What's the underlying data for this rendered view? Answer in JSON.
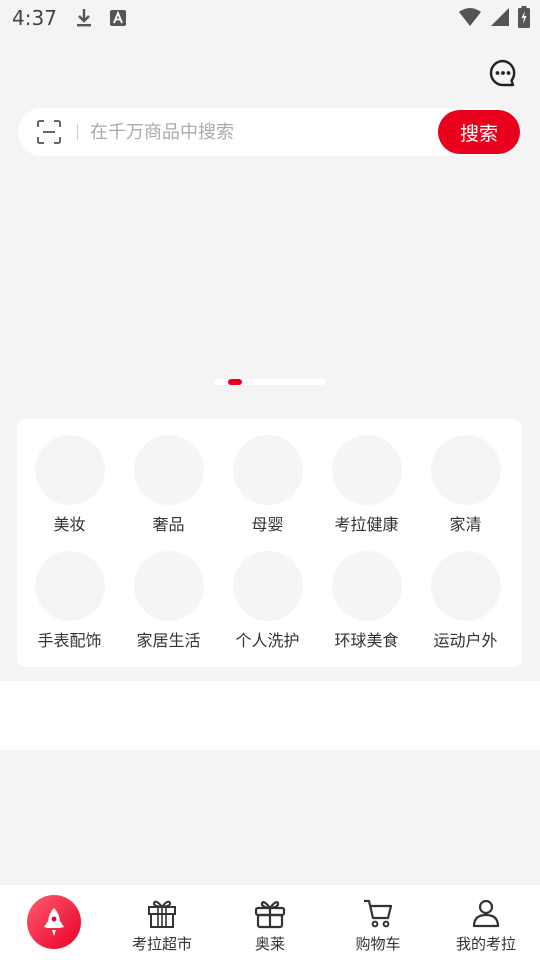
{
  "status_bar": {
    "time": "4:37",
    "icons": [
      "download-icon",
      "a-letter-icon",
      "wifi-icon",
      "signal-icon",
      "battery-icon"
    ]
  },
  "header": {
    "message_icon": "chat-bubble-icon"
  },
  "search": {
    "placeholder": "在千万商品中搜索",
    "value": "",
    "button_label": "搜索",
    "scan_icon": "scan-icon"
  },
  "banner": {
    "pages": 2,
    "active_index": 0
  },
  "categories": [
    {
      "label": "美妆"
    },
    {
      "label": "奢品"
    },
    {
      "label": "母婴"
    },
    {
      "label": "考拉健康"
    },
    {
      "label": "家清"
    },
    {
      "label": "手表配饰"
    },
    {
      "label": "家居生活"
    },
    {
      "label": "个人洗护"
    },
    {
      "label": "环球美食"
    },
    {
      "label": "运动户外"
    }
  ],
  "bottom_nav": {
    "items": [
      {
        "label": "",
        "icon": "rocket-icon",
        "active": true
      },
      {
        "label": "考拉超市",
        "icon": "gift-icon"
      },
      {
        "label": "奥莱",
        "icon": "gift-box-icon"
      },
      {
        "label": "购物车",
        "icon": "cart-icon"
      },
      {
        "label": "我的考拉",
        "icon": "user-icon"
      }
    ]
  },
  "colors": {
    "accent": "#e8001c",
    "background": "#f4f4f4"
  }
}
